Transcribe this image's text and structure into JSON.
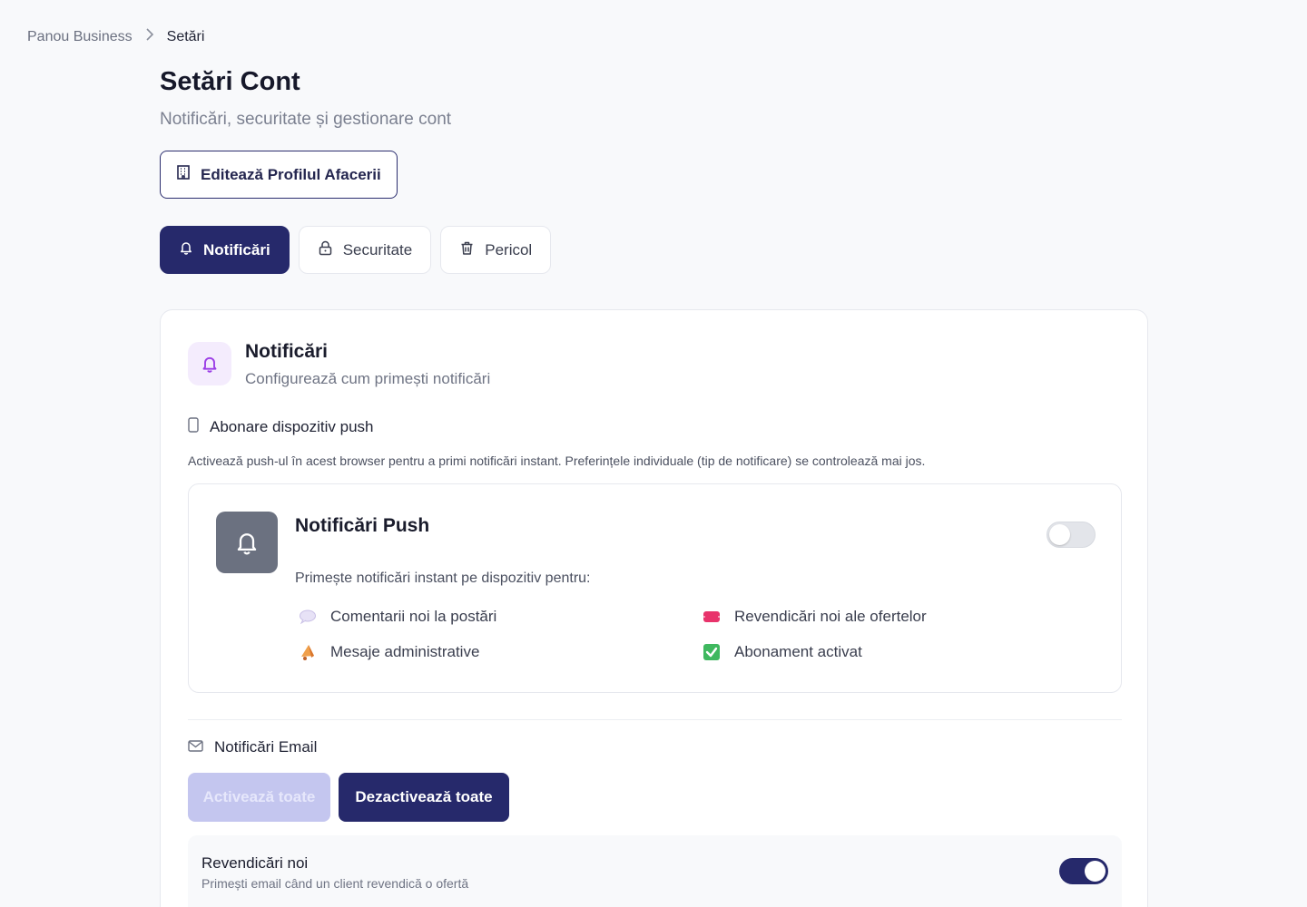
{
  "breadcrumb": {
    "root": "Panou Business",
    "separator": ">",
    "current": "Setări"
  },
  "header": {
    "title": "Setări Cont",
    "subtitle": "Notificări, securitate și gestionare cont",
    "edit_profile_label": "Editează Profilul Afacerii"
  },
  "tabs": [
    {
      "label": "Notificări",
      "icon": "bell-icon",
      "active": true
    },
    {
      "label": "Securitate",
      "icon": "lock-icon",
      "active": false
    },
    {
      "label": "Pericol",
      "icon": "trash-icon",
      "active": false
    }
  ],
  "card": {
    "title": "Notificări",
    "subtitle": "Configurează cum primești notificări",
    "push_section": {
      "heading": "Abonare dispozitiv push",
      "description": "Activează push-ul în acest browser pentru a primi notificări instant. Preferințele individuale (tip de notificare) se controlează mai jos.",
      "box": {
        "title": "Notificări Push",
        "subtitle": "Primește notificări instant pe dispozitiv pentru:",
        "enabled": false,
        "features": [
          {
            "icon": "speech-bubble-icon",
            "label": "Comentarii noi la postări"
          },
          {
            "icon": "ticket-icon",
            "label": "Revendicări noi ale ofertelor"
          },
          {
            "icon": "megaphone-icon",
            "label": "Mesaje administrative"
          },
          {
            "icon": "check-mark-icon",
            "label": "Abonament activat"
          }
        ]
      }
    },
    "email_section": {
      "heading": "Notificări Email",
      "enable_all_label": "Activează toate",
      "disable_all_label": "Dezactivează toate",
      "rows": [
        {
          "title": "Revendicări noi",
          "description": "Primești email când un client revendică o ofertă",
          "enabled": true
        }
      ]
    }
  },
  "colors": {
    "primary": "#26296b",
    "accent_purple": "#9b3de6",
    "background": "#f8f9fb"
  }
}
